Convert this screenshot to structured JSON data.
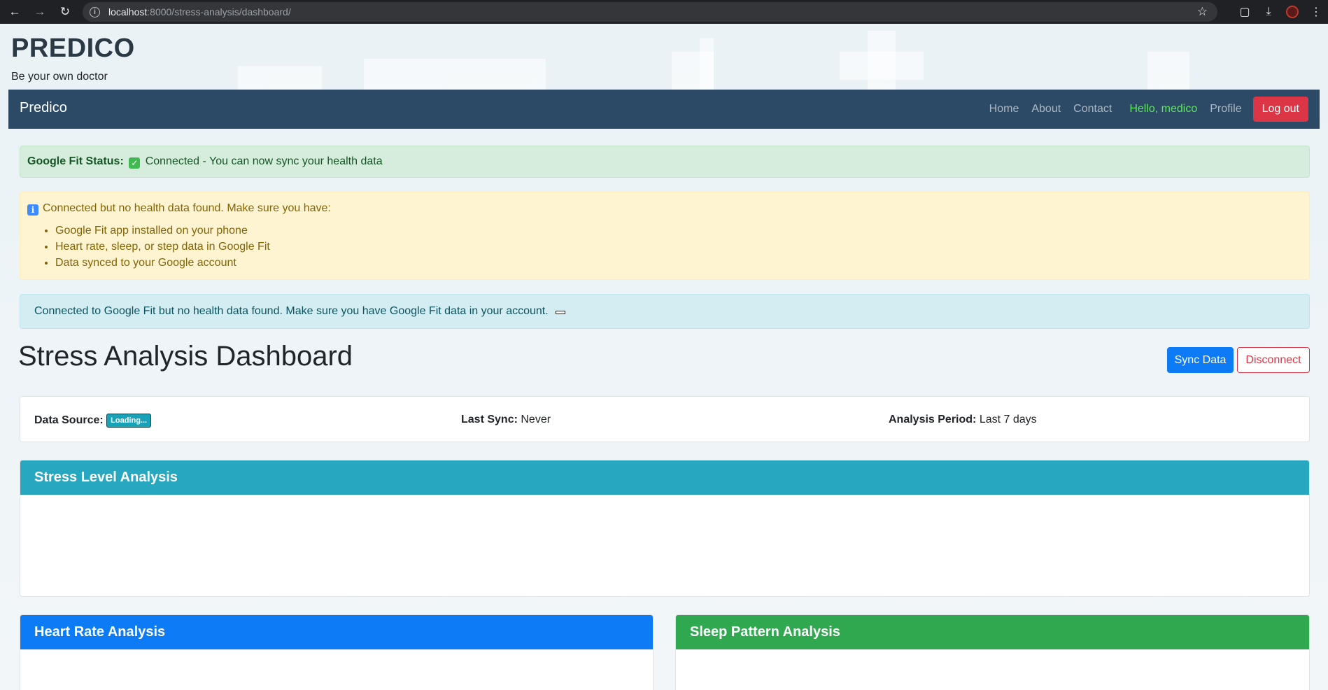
{
  "browser": {
    "url_host": "localhost",
    "url_path": ":8000/stress-analysis/dashboard/"
  },
  "site": {
    "title": "PREDICO",
    "tagline": "Be your own doctor"
  },
  "navbar": {
    "brand": "Predico",
    "links": [
      "Home",
      "About",
      "Contact"
    ],
    "greeting": "Hello, medico",
    "profile": "Profile",
    "logout": "Log out"
  },
  "alerts": {
    "success_label": "Google Fit Status:",
    "success_text": "Connected - You can now sync your health data",
    "warning_intro": "Connected but no health data found. Make sure you have:",
    "warning_items": [
      "Google Fit app installed on your phone",
      "Heart rate, sleep, or step data in Google Fit",
      "Data synced to your Google account"
    ],
    "info_text": "Connected to Google Fit but no health data found. Make sure you have Google Fit data in your account."
  },
  "dashboard": {
    "title": "Stress Analysis Dashboard",
    "sync_button": "Sync Data",
    "disconnect_button": "Disconnect"
  },
  "info_card": {
    "data_source_label": "Data Source:",
    "data_source_value": "Loading...",
    "last_sync_label": "Last Sync:",
    "last_sync_value": "Never",
    "period_label": "Analysis Period:",
    "period_value": "Last 7 days"
  },
  "panels": {
    "stress": "Stress Level Analysis",
    "heart": "Heart Rate Analysis",
    "sleep": "Sleep Pattern Analysis"
  },
  "colors": {
    "navbar": "#2c4a66",
    "logout": "#dc3545",
    "sync": "#0d7bf5",
    "stress_header": "#27a8c0",
    "heart_header": "#0d7bf5",
    "sleep_header": "#2fa84f",
    "greeting": "#5ce65c"
  }
}
